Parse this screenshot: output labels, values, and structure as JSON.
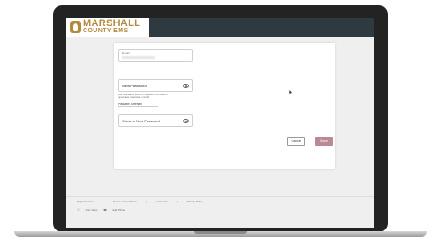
{
  "brand": {
    "name_line1": "MARSHALL",
    "name_line2": "COUNTY EMS",
    "colors": {
      "gold": "#b48a3c",
      "header": "#2e3a40",
      "save_button": "#b98a94"
    }
  },
  "form": {
    "first_field_label": "Email",
    "new_password_label": "New Password",
    "password_hint": "8-20 characters with 1-2 characters from each of: uppercase, lowercase, number",
    "strength_label": "Password Strength",
    "confirm_password_label": "Confirm New Password",
    "cancel_label": "Cancel",
    "save_label": "Save",
    "eye_icon": "eye-icon"
  },
  "footer": {
    "links": [
      "Digital Services",
      "Terms and Conditions",
      "Contact Us",
      "Privacy Policy"
    ],
    "row2": [
      "Join Team",
      "Add Phone"
    ]
  }
}
